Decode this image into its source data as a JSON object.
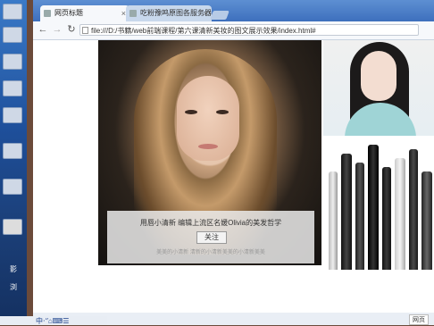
{
  "desktop": {
    "labels": [
      "",
      "",
      "",
      "",
      "",
      "",
      "",
      "",
      "",
      "影",
      "影"
    ],
    "icon_count": 8,
    "bottom_labels": [
      "影",
      "浏"
    ]
  },
  "browser": {
    "tabs": [
      {
        "title": "网页标题",
        "active": true
      },
      {
        "title": "吃粉豫鸣原图各服务器错题",
        "active": false
      }
    ],
    "nav": {
      "back": "←",
      "forward": "→",
      "reload": "↻"
    },
    "address": "file:///D:/书籍/web前端课程/第六课清新美妆的图文展示效果/index.html#"
  },
  "page": {
    "caption": "用唇小清新 编辑上流区名媛Olivia的美发哲学",
    "button_label": "关注",
    "sub_caption": "美美的小清新 清新的小清新美美的小清新美美"
  },
  "status": {
    "tip": "网页"
  },
  "taskbar": {
    "ime": "中‧‘′⌂⌨☰"
  },
  "colors": {
    "tabbar": "#4a7cc7",
    "caption_bg": "#ebebeb",
    "desktop": "#2a5aa8"
  }
}
